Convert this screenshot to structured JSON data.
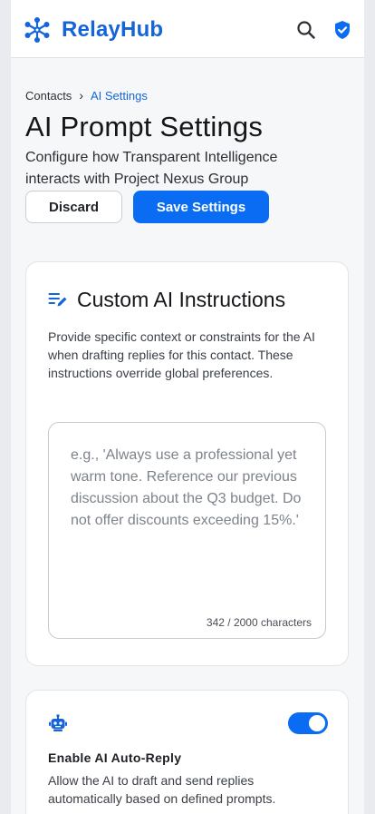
{
  "app": {
    "brand": "RelayHub",
    "accent_color": "#0a6cf3",
    "brand_color": "#1565d8"
  },
  "header": {
    "search_icon": "search-icon",
    "shield_icon": "shield-check-icon"
  },
  "breadcrumb": {
    "parent": "Contacts",
    "current": "AI Settings"
  },
  "page": {
    "title": "AI Prompt Settings",
    "subtitle": "Configure how Transparent Intelligence interacts with Project Nexus Group"
  },
  "actions": {
    "discard_label": "Discard",
    "save_label": "Save Settings"
  },
  "custom_instructions": {
    "icon": "edit-list-icon",
    "title": "Custom AI Instructions",
    "description": "Provide specific context or constraints for the AI when drafting replies for this contact. These instructions override global preferences.",
    "placeholder": "e.g., 'Always use a professional yet warm tone. Reference our previous discussion about the Q3 budget. Do not offer discounts exceeding 15%.'",
    "char_count": "342 / 2000 characters"
  },
  "auto_reply": {
    "icon": "robot-icon",
    "title": "Enable AI Auto-Reply",
    "description": "Allow the AI to draft and send replies automatically based on defined prompts.",
    "enabled": true
  }
}
